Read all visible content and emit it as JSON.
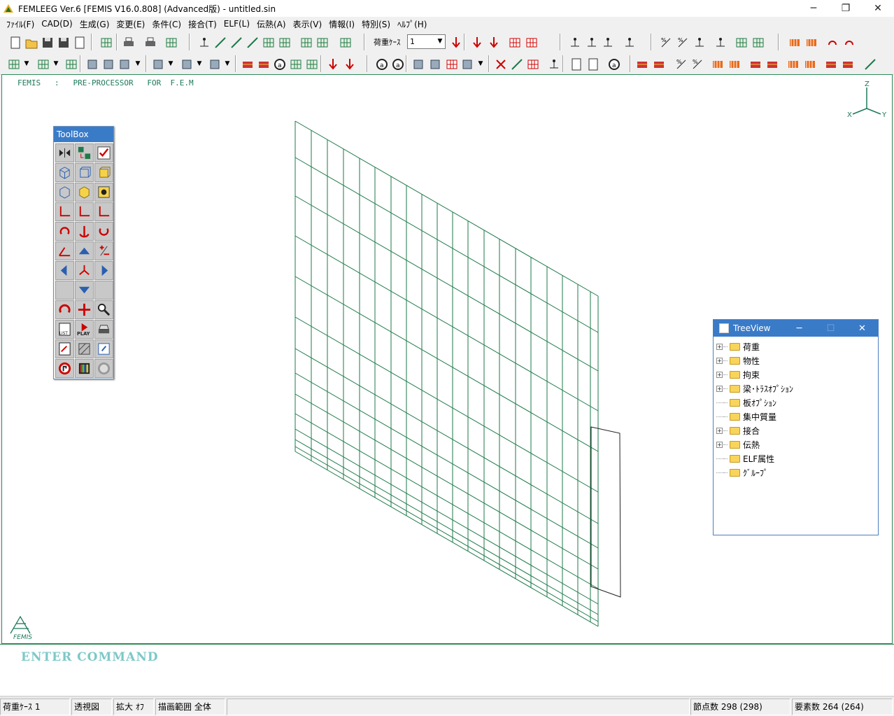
{
  "window": {
    "title": "FEMLEEG Ver.6 [FEMIS V16.0.808] (Advanced版) - untitled.sin"
  },
  "menu": [
    "ﾌｧｲﾙ(F)",
    "CAD(D)",
    "生成(G)",
    "変更(E)",
    "条件(C)",
    "接合(T)",
    "ELF(L)",
    "伝熱(A)",
    "表示(V)",
    "情報(I)",
    "特別(S)",
    "ﾍﾙﾌﾟ(H)"
  ],
  "toolbar": {
    "loadcase_label": "荷重ｹｰｽ",
    "loadcase_value": "1"
  },
  "canvas": {
    "banner": "FEMIS   :   PRE-PROCESSOR   FOR  F.E.M",
    "axis_labels": {
      "z": "Z",
      "x": "X",
      "y": "Y"
    },
    "logo_text": "FEMIS"
  },
  "toolbox": {
    "title": "ToolBox",
    "play_label": "PLAY",
    "list_label": "LIST"
  },
  "treeview": {
    "title": "TreeView",
    "items": [
      {
        "label": "荷重",
        "expandable": true
      },
      {
        "label": "物性",
        "expandable": true
      },
      {
        "label": "拘束",
        "expandable": true
      },
      {
        "label": "梁･ﾄﾗｽｵﾌﾟｼｮﾝ",
        "expandable": true
      },
      {
        "label": "板ｵﾌﾟｼｮﾝ",
        "expandable": false
      },
      {
        "label": "集中質量",
        "expandable": false
      },
      {
        "label": "接合",
        "expandable": true
      },
      {
        "label": "伝熱",
        "expandable": true
      },
      {
        "label": "ELF属性",
        "expandable": false
      },
      {
        "label": "ｸﾞﾙｰﾌﾟ",
        "expandable": false
      }
    ]
  },
  "command": {
    "prompt": "ENTER COMMAND"
  },
  "status": {
    "loadcase": "荷重ｹｰｽ 1",
    "view": "透視図",
    "zoom": "拡大 ｵﾌ",
    "range": "描画範囲 全体",
    "nodes": "節点数 298 (298)",
    "elements": "要素数 264 (264)"
  },
  "colors": {
    "mesh": "#1e7a4a",
    "titlebar_active": "#3a7bc8",
    "command_text": "#7ec8c8"
  }
}
